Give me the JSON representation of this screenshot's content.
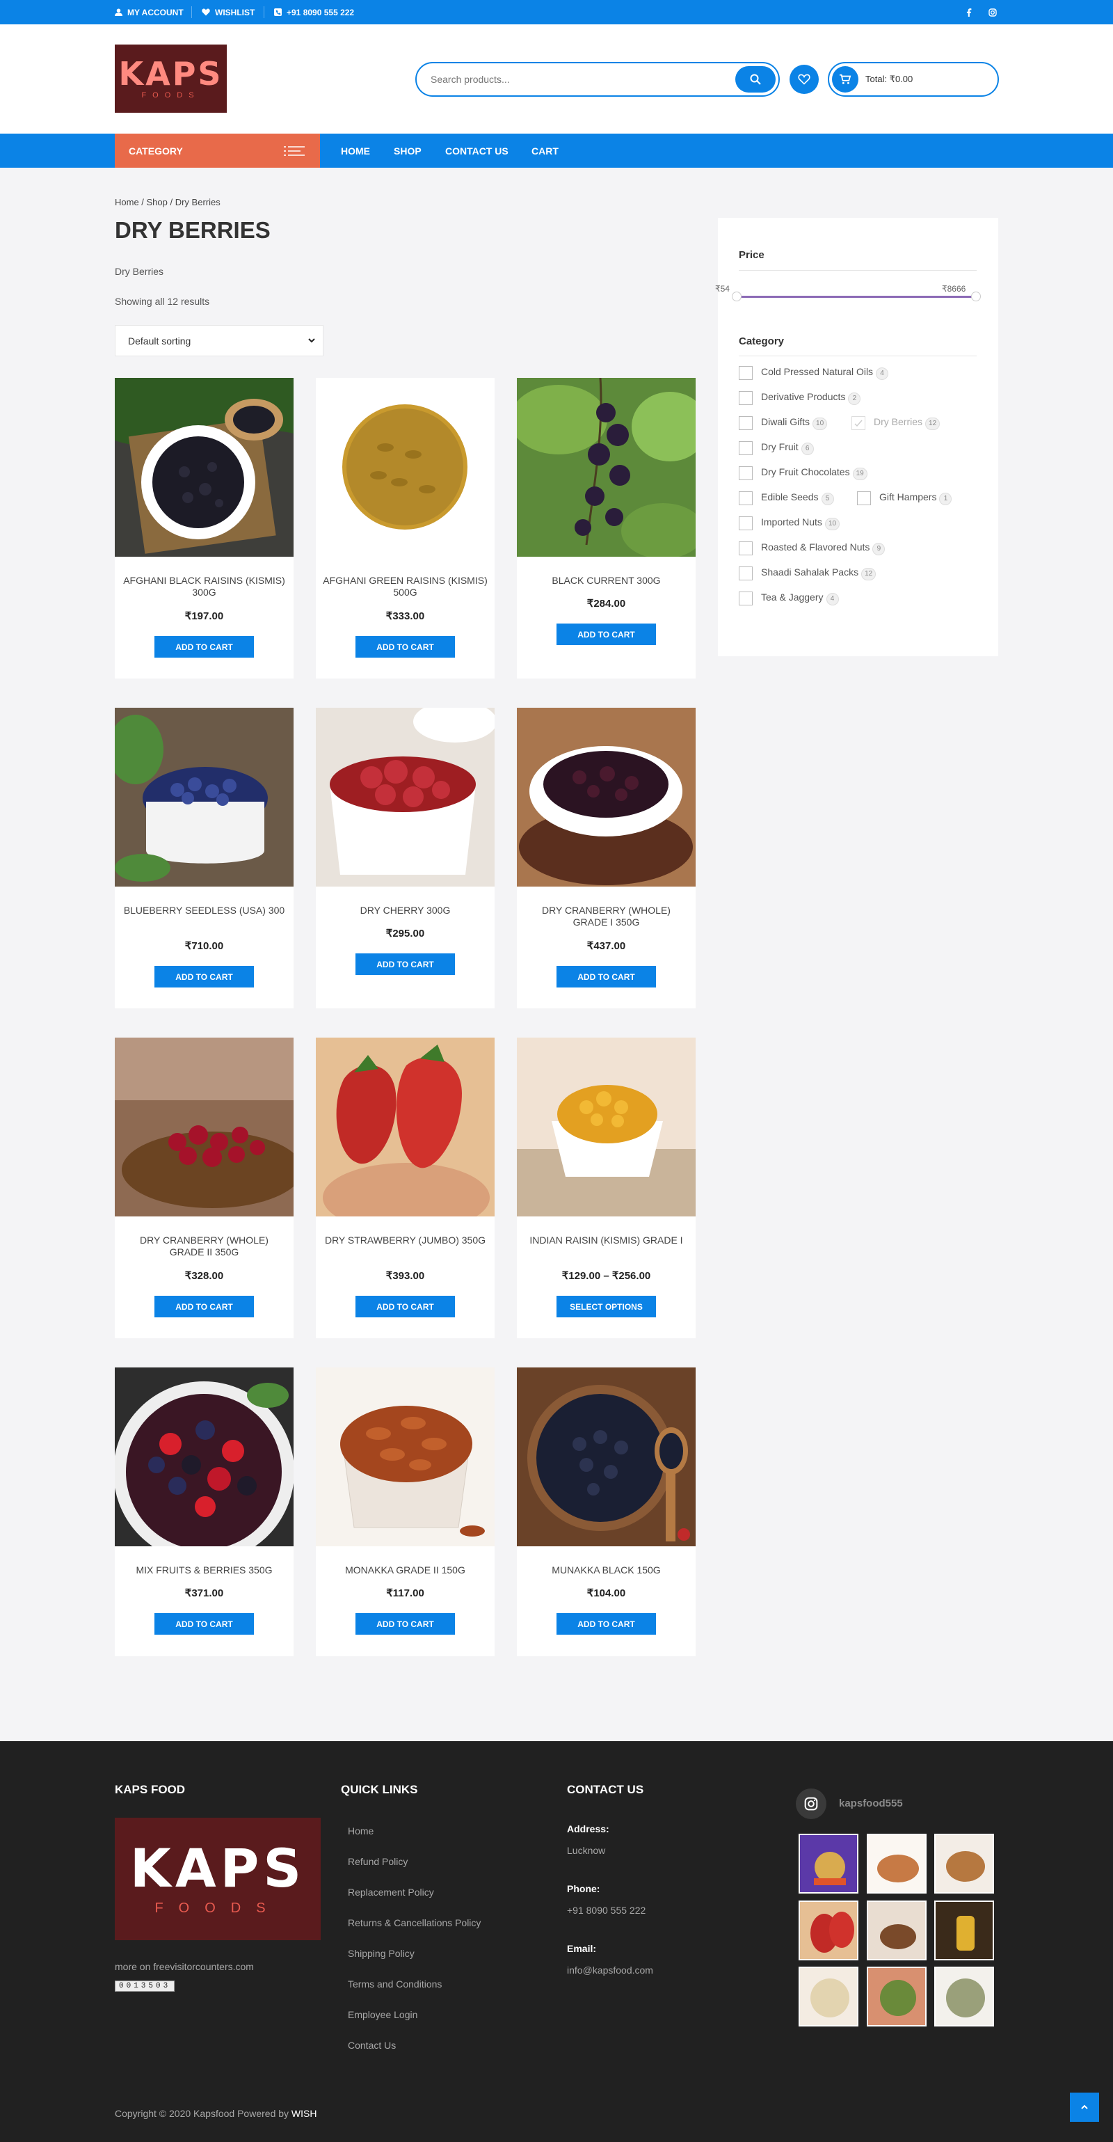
{
  "topbar": {
    "account": "MY ACCOUNT",
    "wishlist": "WISHLIST",
    "phone": "+91 8090 555 222",
    "social": [
      "facebook-icon",
      "instagram-icon"
    ]
  },
  "header": {
    "logo_text": "KAPS",
    "logo_sub": "FOODS",
    "search_placeholder": "Search products...",
    "cart_total": "Total: ₹0.00"
  },
  "nav": {
    "category": "CATEGORY",
    "links": [
      "HOME",
      "SHOP",
      "CONTACT US",
      "CART"
    ]
  },
  "page": {
    "breadcrumb": "Home / Shop / Dry Berries",
    "title": "DRY BERRIES",
    "description": "Dry Berries",
    "results": "Showing all 12 results",
    "sort": "Default sorting"
  },
  "products": [
    {
      "name": "AFGHANI BLACK RAISINS (KISMIS) 300g",
      "price": "₹197.00",
      "button": "ADD TO CART"
    },
    {
      "name": "AFGHANI GREEN RAISINS (KISMIS) 500g",
      "price": "₹333.00",
      "button": "ADD TO CART"
    },
    {
      "name": "BLACK CURRENT 300g",
      "price": "₹284.00",
      "button": "ADD TO CART"
    },
    {
      "name": "BLUEBERRY SEEDLESS (USA) 300",
      "price": "₹710.00",
      "button": "ADD TO CART"
    },
    {
      "name": "DRY CHERRY 300g",
      "price": "₹295.00",
      "button": "ADD TO CART"
    },
    {
      "name": "DRY CRANBERRY (WHOLE) GRADE I 350g",
      "price": "₹437.00",
      "button": "ADD TO CART"
    },
    {
      "name": "DRY CRANBERRY (WHOLE) GRADE II 350g",
      "price": "₹328.00",
      "button": "ADD TO CART"
    },
    {
      "name": "DRY STRAWBERRY (JUMBO) 350g",
      "price": "₹393.00",
      "button": "ADD TO CART"
    },
    {
      "name": "INDIAN RAISIN (KISMIS) GRADE I",
      "price": "₹129.00 – ₹256.00",
      "button": "SELECT OPTIONS"
    },
    {
      "name": "MIX FRUITS & BERRIES 350g",
      "price": "₹371.00",
      "button": "ADD TO CART"
    },
    {
      "name": "MONAKKA GRADE II 150g",
      "price": "₹117.00",
      "button": "ADD TO CART"
    },
    {
      "name": "MUNAKKA BLACK 150g",
      "price": "₹104.00",
      "button": "ADD TO CART"
    }
  ],
  "sidebar": {
    "price_title": "Price",
    "price_min": "₹54",
    "price_max": "₹8666",
    "category_title": "Category",
    "categories": [
      {
        "label": "Cold Pressed Natural Oils",
        "count": "4"
      },
      {
        "label": "Derivative Products",
        "count": "2"
      },
      {
        "label": "Diwali Gifts",
        "count": "10"
      },
      {
        "label": "Dry Berries",
        "count": "12"
      },
      {
        "label": "Dry Fruit",
        "count": "6"
      },
      {
        "label": "Dry Fruit Chocolates",
        "count": "19"
      },
      {
        "label": "Edible Seeds",
        "count": "5"
      },
      {
        "label": "Gift Hampers",
        "count": "1"
      },
      {
        "label": "Imported Nuts",
        "count": "10"
      },
      {
        "label": "Roasted & Flavored Nuts",
        "count": "9"
      },
      {
        "label": "Shaadi Sahalak Packs",
        "count": "12"
      },
      {
        "label": "Tea & Jaggery",
        "count": "4"
      }
    ]
  },
  "footer": {
    "col1_title": "KAPS FOOD",
    "counter_text": "more on freevisitorcounters.com",
    "counter_value": "0013503",
    "col2_title": "QUICK LINKS",
    "links": [
      "Home",
      "Refund Policy",
      "Replacement Policy",
      "Returns & Cancellations Policy",
      "Shipping Policy",
      "Terms and Conditions",
      "Employee Login",
      "Contact Us"
    ],
    "col3_title": "CONTACT US",
    "address_label": "Address:",
    "address": "Lucknow",
    "phone_label": "Phone:",
    "phone": "+91 8090 555 222",
    "email_label": "Email:",
    "email": "info@kapsfood.com",
    "instagram_handle": "kapsfood555",
    "copyright": "Copyright © 2020 Kapsfood Powered by",
    "powered": "WISH"
  },
  "colors": {
    "primary": "#0b83e6",
    "accent": "#e86a4a",
    "footer": "#212121"
  }
}
